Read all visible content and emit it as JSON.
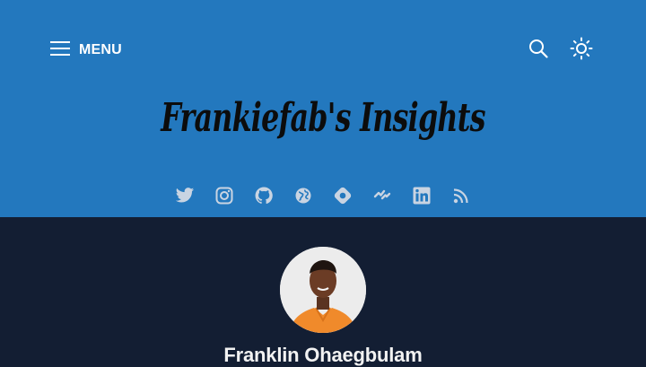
{
  "header": {
    "menu_label": "MENU",
    "logo_text": "Frankiefab's Insights",
    "background": "#2378be"
  },
  "icons": {
    "menu": "hamburger-icon",
    "search": "search-icon",
    "theme": "sun-icon"
  },
  "socials": [
    {
      "name": "twitter",
      "icon": "twitter-icon"
    },
    {
      "name": "instagram",
      "icon": "instagram-icon"
    },
    {
      "name": "github",
      "icon": "github-icon"
    },
    {
      "name": "website",
      "icon": "globe-icon"
    },
    {
      "name": "hashnode",
      "icon": "hashnode-icon"
    },
    {
      "name": "devto",
      "icon": "devto-icon"
    },
    {
      "name": "linkedin",
      "icon": "linkedin-icon"
    },
    {
      "name": "rss",
      "icon": "rss-icon"
    }
  ],
  "profile": {
    "name": "Franklin Ohaegbulam",
    "avatar": "avatar-photo"
  },
  "colors": {
    "body_background": "#131e33",
    "icon_color": "#c9d4e2",
    "header_text": "#ffffff"
  }
}
